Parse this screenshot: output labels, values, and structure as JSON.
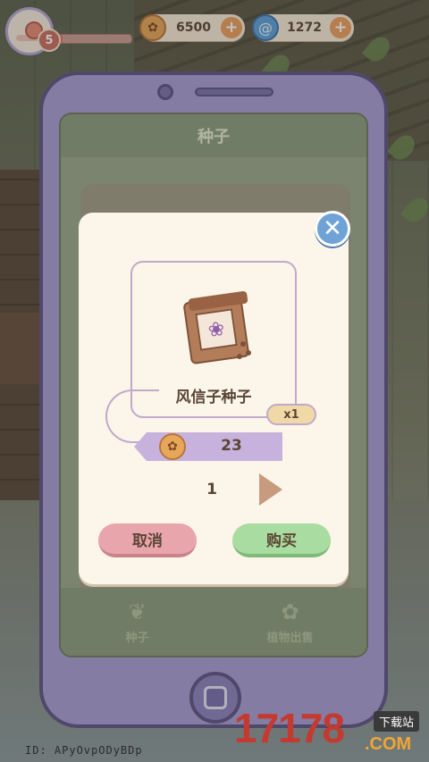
{
  "hud": {
    "level": "5",
    "xp_fraction": 0.06,
    "coins": "6500",
    "gems": "1272",
    "coin_icon": "coin-icon",
    "gem_icon": "swirl-gem-icon"
  },
  "phone": {
    "screen_title": "种子",
    "tabs": [
      {
        "label": "种子",
        "icon": "sprout-icon"
      },
      {
        "label": "植物出售",
        "icon": "flower-icon"
      }
    ]
  },
  "popup": {
    "item_name": "风信子种子",
    "quantity_badge": "x1",
    "price": "23",
    "count": "1",
    "cancel_label": "取消",
    "buy_label": "购买"
  },
  "watermark": {
    "id_text": "ID: APyOvpODyBDp",
    "logo": "17178",
    "logo_suffix": ".COM",
    "sub": "下载站"
  },
  "colors": {
    "phone_frame": "#a89fd6",
    "cancel_button": "#e9a5ac",
    "buy_button": "#a9dca0",
    "close_button": "#6fa3d8"
  }
}
